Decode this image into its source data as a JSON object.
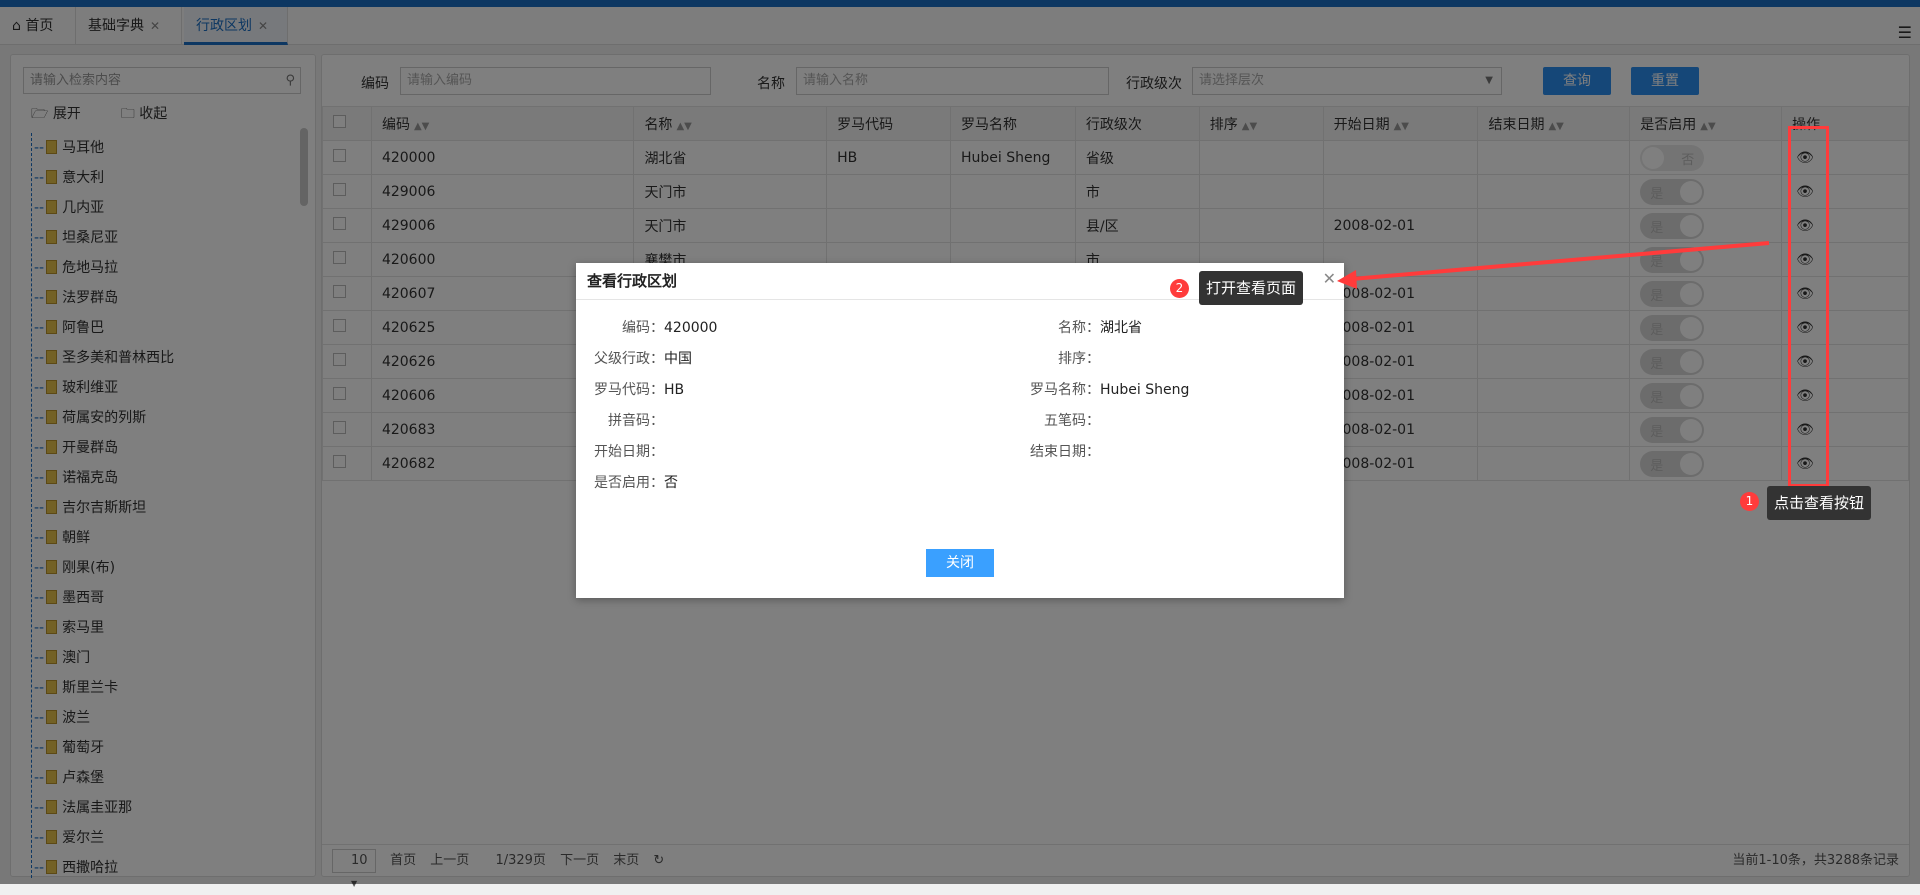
{
  "tabs": [
    {
      "label": "首页",
      "icon": "home-icon"
    },
    {
      "label": "基础字典",
      "close": "✕"
    },
    {
      "label": "行政区划",
      "close": "✕",
      "active": true
    }
  ],
  "tree": {
    "search_placeholder": "请输入检索内容",
    "expand": "展开",
    "collapse": "收起",
    "items": [
      "马耳他",
      "意大利",
      "几内亚",
      "坦桑尼亚",
      "危地马拉",
      "法罗群岛",
      "阿鲁巴",
      "圣多美和普林西比",
      "玻利维亚",
      "荷属安的列斯",
      "开曼群岛",
      "诺福克岛",
      "吉尔吉斯斯坦",
      "朝鲜",
      "刚果(布)",
      "墨西哥",
      "索马里",
      "澳门",
      "斯里兰卡",
      "波兰",
      "葡萄牙",
      "卢森堡",
      "法属圭亚那",
      "爱尔兰",
      "西撒哈拉"
    ]
  },
  "filters": {
    "code_label": "编码",
    "code_placeholder": "请输入编码",
    "name_label": "名称",
    "name_placeholder": "请输入名称",
    "level_label": "行政级次",
    "level_placeholder": "请选择层次",
    "query": "查询",
    "reset": "重置"
  },
  "table": {
    "columns": [
      "编码",
      "名称",
      "罗马代码",
      "罗马名称",
      "行政级次",
      "排序",
      "开始日期",
      "结束日期",
      "是否启用",
      "操作"
    ],
    "rows": [
      {
        "code": "420000",
        "name": "湖北省",
        "roman_code": "HB",
        "roman_name": "Hubei Sheng",
        "level": "省级",
        "sort": "",
        "start": "",
        "end": "",
        "enabled": "否"
      },
      {
        "code": "429006",
        "name": "天门市",
        "roman_code": "",
        "roman_name": "",
        "level": "市",
        "sort": "",
        "start": "",
        "end": "",
        "enabled": "是"
      },
      {
        "code": "429006",
        "name": "天门市",
        "roman_code": "",
        "roman_name": "",
        "level": "县/区",
        "sort": "",
        "start": "2008-02-01",
        "end": "",
        "enabled": "是"
      },
      {
        "code": "420600",
        "name": "襄樊市",
        "roman_code": "",
        "roman_name": "",
        "level": "市",
        "sort": "",
        "start": "",
        "end": "",
        "enabled": "是"
      },
      {
        "code": "420607",
        "name": "",
        "roman_code": "",
        "roman_name": "",
        "level": "",
        "sort": "",
        "start": "2008-02-01",
        "end": "",
        "enabled": "是"
      },
      {
        "code": "420625",
        "name": "",
        "roman_code": "",
        "roman_name": "",
        "level": "",
        "sort": "",
        "start": "2008-02-01",
        "end": "",
        "enabled": "是"
      },
      {
        "code": "420626",
        "name": "",
        "roman_code": "",
        "roman_name": "",
        "level": "",
        "sort": "",
        "start": "2008-02-01",
        "end": "",
        "enabled": "是"
      },
      {
        "code": "420606",
        "name": "",
        "roman_code": "",
        "roman_name": "",
        "level": "",
        "sort": "",
        "start": "2008-02-01",
        "end": "",
        "enabled": "是"
      },
      {
        "code": "420683",
        "name": "",
        "roman_code": "",
        "roman_name": "",
        "level": "",
        "sort": "",
        "start": "2008-02-01",
        "end": "",
        "enabled": "是"
      },
      {
        "code": "420682",
        "name": "",
        "roman_code": "",
        "roman_name": "",
        "level": "",
        "sort": "",
        "start": "2008-02-01",
        "end": "",
        "enabled": "是"
      }
    ]
  },
  "pager": {
    "size": "10",
    "first": "首页",
    "prev": "上一页",
    "page": "1/329页",
    "next": "下一页",
    "last": "末页",
    "summary": "当前1-10条，共3288条记录"
  },
  "dialog": {
    "title": "查看行政区划",
    "close_label": "关闭",
    "fields": [
      {
        "label": "编码：",
        "value": "420000"
      },
      {
        "label": "名称：",
        "value": "湖北省"
      },
      {
        "label": "父级行政：",
        "value": "中国"
      },
      {
        "label": "排序：",
        "value": ""
      },
      {
        "label": "罗马代码：",
        "value": "HB"
      },
      {
        "label": "罗马名称：",
        "value": "Hubei Sheng"
      },
      {
        "label": "拼音码：",
        "value": ""
      },
      {
        "label": "五笔码：",
        "value": ""
      },
      {
        "label": "开始日期：",
        "value": ""
      },
      {
        "label": "结束日期：",
        "value": ""
      },
      {
        "label": "是否启用：",
        "value": "否"
      }
    ]
  },
  "annotations": [
    {
      "num": "1",
      "text": "点击查看按钮"
    },
    {
      "num": "2",
      "text": "打开查看页面"
    }
  ],
  "colors": {
    "accent": "#2b8ef0",
    "annotation": "#ff3b3b"
  }
}
